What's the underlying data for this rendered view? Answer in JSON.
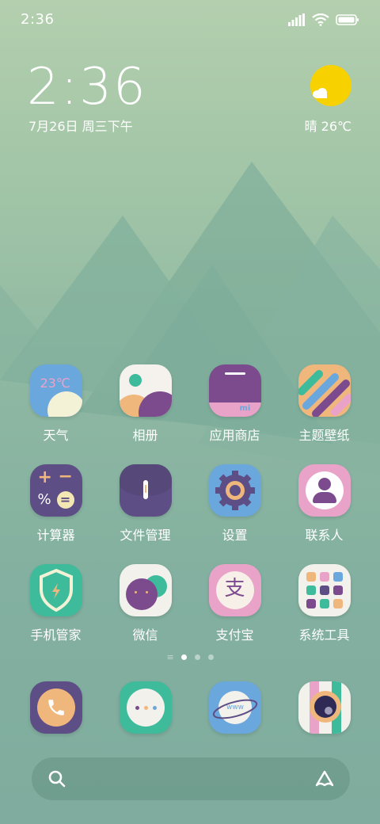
{
  "status": {
    "time": "2:36"
  },
  "lockclock": {
    "time": "2:36",
    "date": "7月26日 周三下午"
  },
  "weather": {
    "text": "晴 26℃",
    "icon": "sun-cloud-icon",
    "temp_icon": "23℃"
  },
  "apps": [
    {
      "label": "天气",
      "icon": "weather-app-icon"
    },
    {
      "label": "相册",
      "icon": "gallery-app-icon"
    },
    {
      "label": "应用商店",
      "icon": "app-store-icon"
    },
    {
      "label": "主题壁纸",
      "icon": "themes-app-icon"
    },
    {
      "label": "计算器",
      "icon": "calculator-app-icon"
    },
    {
      "label": "文件管理",
      "icon": "file-manager-icon"
    },
    {
      "label": "设置",
      "icon": "settings-gear-icon"
    },
    {
      "label": "联系人",
      "icon": "contacts-app-icon"
    },
    {
      "label": "手机管家",
      "icon": "security-shield-icon"
    },
    {
      "label": "微信",
      "icon": "wechat-app-icon"
    },
    {
      "label": "支付宝",
      "icon": "alipay-app-icon"
    },
    {
      "label": "系统工具",
      "icon": "system-tools-folder-icon"
    }
  ],
  "dock": [
    {
      "name": "phone-app-icon"
    },
    {
      "name": "messages-app-icon"
    },
    {
      "name": "browser-app-icon"
    },
    {
      "name": "camera-app-icon"
    }
  ],
  "colors": {
    "sun": "#f8d200",
    "accent_purple": "#7c4b8e",
    "accent_teal": "#3dbb9a",
    "accent_blue": "#6ea9db"
  }
}
